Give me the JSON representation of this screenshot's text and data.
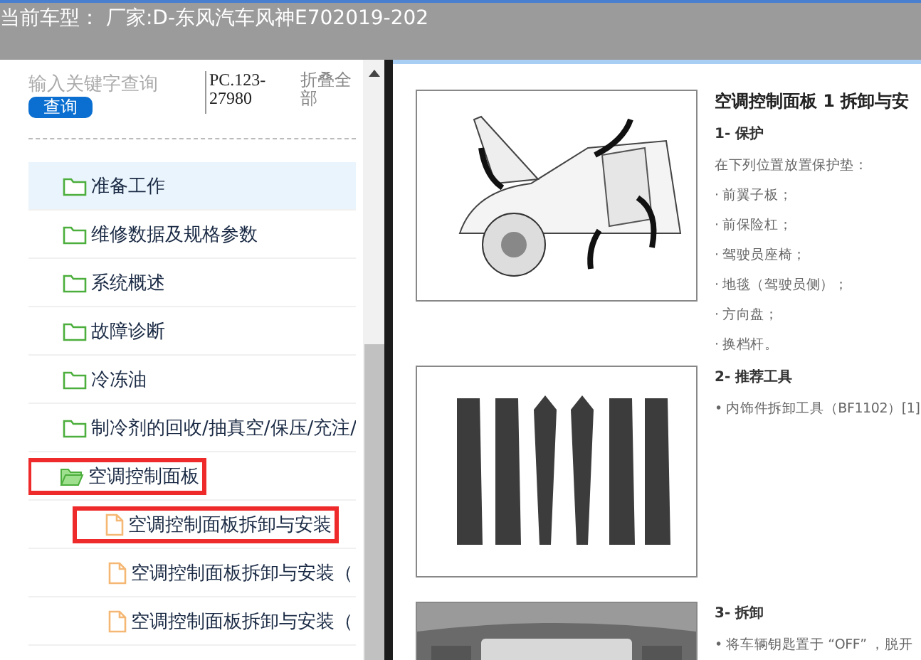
{
  "header": {
    "title": "当前车型： 厂家:D-东风汽车风神E702019-202"
  },
  "search": {
    "placeholder": "输入关键字查询",
    "button": "查询",
    "version": "PC.123-27980",
    "collapse": "折叠全部"
  },
  "tree": [
    {
      "label": "准备工作",
      "kind": "folder",
      "expanded": false,
      "selected": true,
      "highlighted": false
    },
    {
      "label": "维修数据及规格参数",
      "kind": "folder",
      "expanded": false,
      "selected": false,
      "highlighted": false
    },
    {
      "label": "系统概述",
      "kind": "folder",
      "expanded": false,
      "selected": false,
      "highlighted": false
    },
    {
      "label": "故障诊断",
      "kind": "folder",
      "expanded": false,
      "selected": false,
      "highlighted": false
    },
    {
      "label": "冷冻油",
      "kind": "folder",
      "expanded": false,
      "selected": false,
      "highlighted": false
    },
    {
      "label": "制冷剂的回收/抽真空/保压/充注/",
      "kind": "folder",
      "expanded": false,
      "selected": false,
      "highlighted": false
    },
    {
      "label": "空调控制面板",
      "kind": "folder",
      "expanded": true,
      "selected": false,
      "highlighted": true,
      "children": [
        {
          "label": "空调控制面板拆卸与安装",
          "kind": "file",
          "selected": false,
          "highlighted": true
        },
        {
          "label": "空调控制面板拆卸与安装（",
          "kind": "file",
          "selected": false,
          "highlighted": false
        },
        {
          "label": "空调控制面板拆卸与安装（",
          "kind": "file",
          "selected": false,
          "highlighted": false
        }
      ]
    }
  ],
  "document": {
    "title": "空调控制面板 1 拆卸与安",
    "sections": [
      {
        "heading": "1- 保护",
        "lines": [
          "在下列位置放置保护垫：",
          "· 前翼子板；",
          "· 前保险杠；",
          "· 驾驶员座椅；",
          "· 地毯（驾驶员侧）；",
          "· 方向盘；",
          "· 换档杆。"
        ]
      },
      {
        "heading": "2- 推荐工具",
        "lines": [
          "• 内饰件拆卸工具（BF1102）[1]"
        ]
      },
      {
        "heading": "3- 拆卸",
        "lines": [
          "• 将车辆钥匙置于 “OFF” ，脱开"
        ]
      }
    ]
  }
}
